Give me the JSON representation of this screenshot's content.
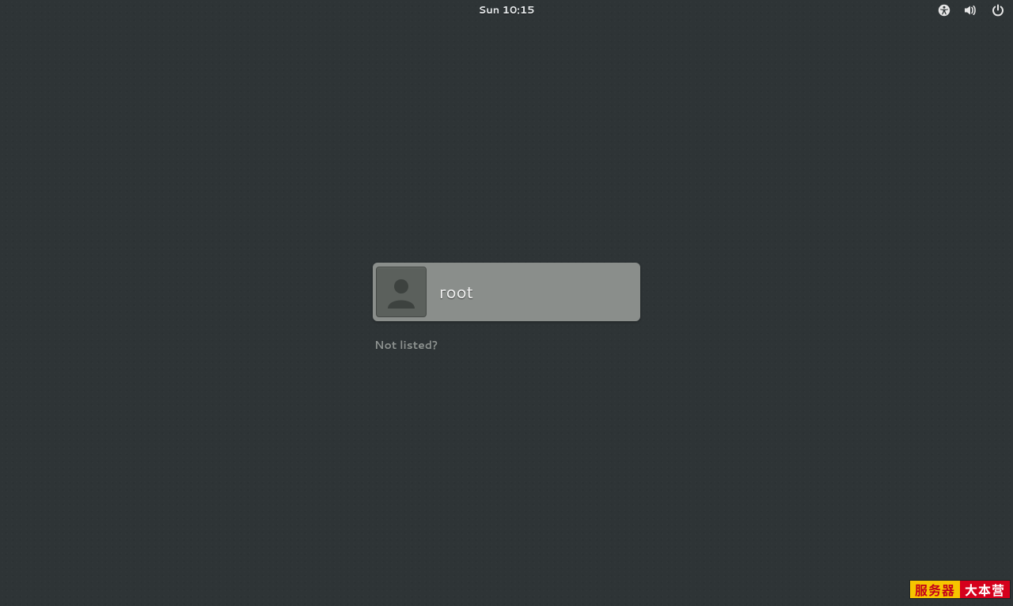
{
  "topbar": {
    "clock": "Sun 10:15"
  },
  "login": {
    "users": [
      {
        "name": "root"
      }
    ],
    "not_listed_label": "Not listed?"
  },
  "watermark": {
    "left": "服务器",
    "right": "大本营"
  },
  "icons": {
    "accessibility": "accessibility-icon",
    "volume": "volume-icon",
    "power": "power-icon",
    "avatar": "avatar-icon"
  }
}
